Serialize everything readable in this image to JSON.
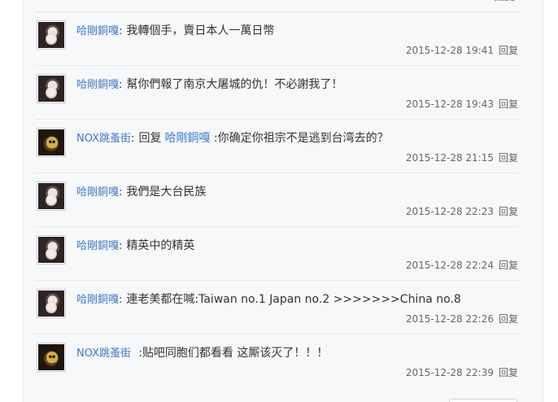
{
  "top_sliver": "回复",
  "comments": [
    {
      "user": "哈剛銅嘎",
      "colon": ":",
      "avatar": "girl",
      "text": "我轉個手，賣日本人一萬日幣",
      "mention": "",
      "after_mention": "",
      "time": "2015-12-28 19:41",
      "reply": "回复"
    },
    {
      "user": "哈剛銅嘎",
      "colon": ":",
      "avatar": "girl",
      "text": "幫你們報了南京大屠城的仇！不必謝我了！",
      "mention": "",
      "after_mention": "",
      "time": "2015-12-28 19:43",
      "reply": "回复"
    },
    {
      "user": "NOX跳蚤街",
      "colon": ":",
      "avatar": "skull",
      "text": "回复",
      "mention": "哈剛銅嘎",
      "after_mention": " :你确定你祖宗不是逃到台湾去的？",
      "time": "2015-12-28 21:15",
      "reply": "回复"
    },
    {
      "user": "哈剛銅嘎",
      "colon": ":",
      "avatar": "girl",
      "text": "我們是大台民族",
      "mention": "",
      "after_mention": "",
      "time": "2015-12-28 22:23",
      "reply": "回复"
    },
    {
      "user": "哈剛銅嘎",
      "colon": ":",
      "avatar": "girl",
      "text": "精英中的精英",
      "mention": "",
      "after_mention": "",
      "time": "2015-12-28 22:24",
      "reply": "回复"
    },
    {
      "user": "哈剛銅嘎",
      "colon": ":",
      "avatar": "girl",
      "text": "連老美都在喊:Taiwan no.1 Japan no.2 >>>>>>>China no.8",
      "mention": "",
      "after_mention": "",
      "time": "2015-12-28 22:26",
      "reply": "回复"
    },
    {
      "user": "NOX跳蚤街",
      "colon": " ",
      "avatar": "skull",
      "text": ":贴吧同胞们都看看 这厮该灭了！！！",
      "mention": "",
      "after_mention": "",
      "time": "2015-12-28 22:39",
      "reply": "回复"
    }
  ]
}
